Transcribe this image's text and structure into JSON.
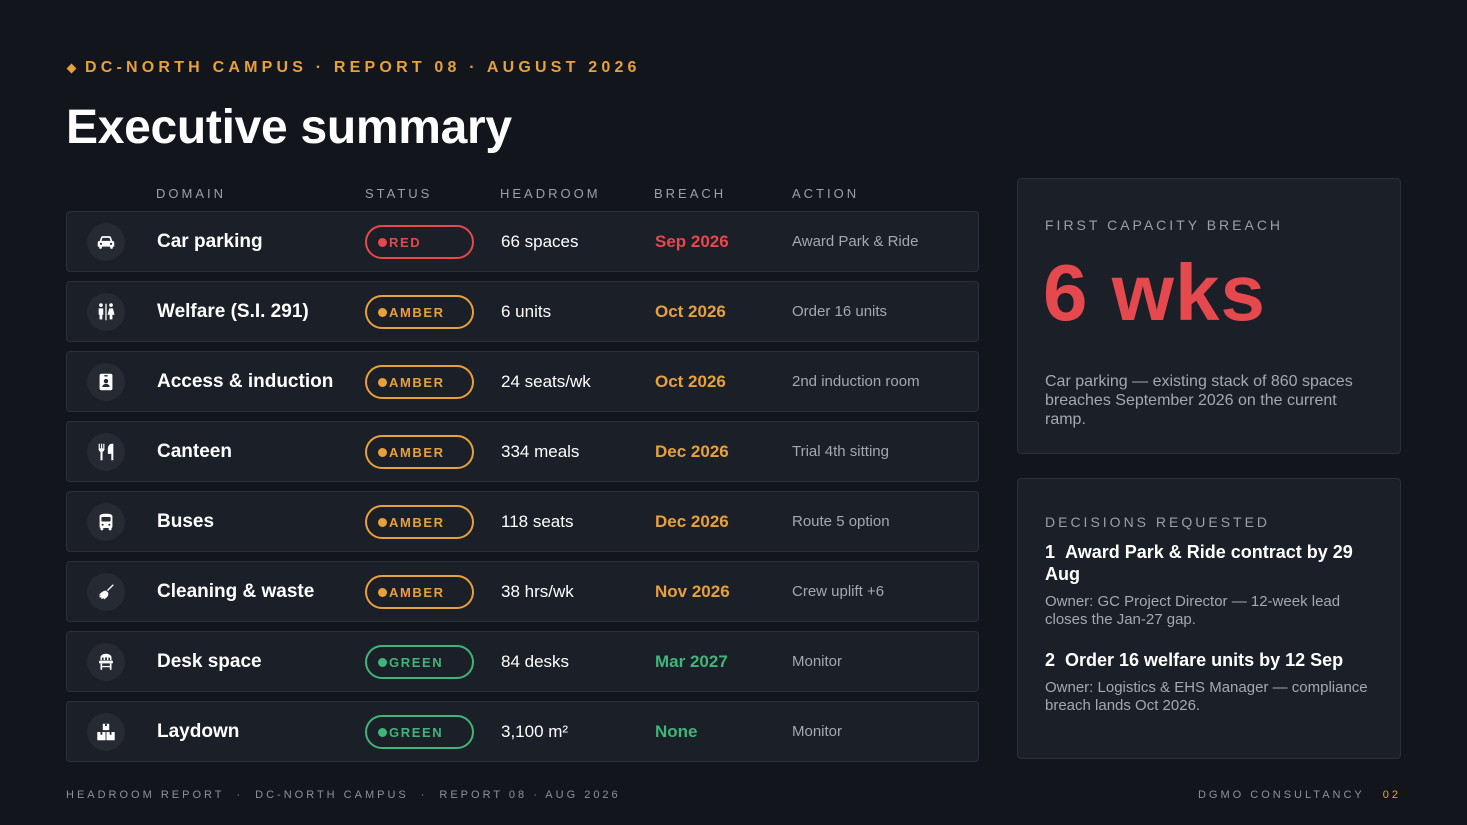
{
  "header": {
    "eyebrow": "DC-NORTH CAMPUS · REPORT 08 · AUGUST 2026",
    "title": "Executive summary"
  },
  "table": {
    "columns": [
      "DOMAIN",
      "STATUS",
      "HEADROOM",
      "BREACH",
      "ACTION"
    ],
    "rows": [
      {
        "icon": "car-icon",
        "domain": "Car parking",
        "status": "RED",
        "status_color": "#e5484d",
        "headroom": "66 spaces",
        "breach": "Sep 2026",
        "action": "Award Park & Ride"
      },
      {
        "icon": "restroom-icon",
        "domain": "Welfare (S.I. 291)",
        "status": "AMBER",
        "status_color": "#e8a03b",
        "headroom": "6 units",
        "breach": "Oct 2026",
        "action": "Order 16 units"
      },
      {
        "icon": "id-badge-icon",
        "domain": "Access & induction",
        "status": "AMBER",
        "status_color": "#e8a03b",
        "headroom": "24 seats/wk",
        "breach": "Oct 2026",
        "action": "2nd induction room"
      },
      {
        "icon": "utensils-icon",
        "domain": "Canteen",
        "status": "AMBER",
        "status_color": "#e8a03b",
        "headroom": "334 meals",
        "breach": "Dec 2026",
        "action": "Trial 4th sitting"
      },
      {
        "icon": "bus-icon",
        "domain": "Buses",
        "status": "AMBER",
        "status_color": "#e8a03b",
        "headroom": "118 seats",
        "breach": "Dec 2026",
        "action": "Route 5 option"
      },
      {
        "icon": "broom-icon",
        "domain": "Cleaning & waste",
        "status": "AMBER",
        "status_color": "#e8a03b",
        "headroom": "38 hrs/wk",
        "breach": "Nov 2026",
        "action": "Crew uplift +6"
      },
      {
        "icon": "chair-icon",
        "domain": "Desk space",
        "status": "GREEN",
        "status_color": "#3fb57a",
        "headroom": "84 desks",
        "breach": "Mar 2027",
        "action": "Monitor"
      },
      {
        "icon": "boxes-icon",
        "domain": "Laydown",
        "status": "GREEN",
        "status_color": "#3fb57a",
        "headroom": "3,100 m²",
        "breach": "None",
        "action": "Monitor"
      }
    ]
  },
  "breach_card": {
    "label": "FIRST CAPACITY BREACH",
    "value": "6 wks",
    "value_color": "#e5484d",
    "description": "Car parking — existing stack of 860 spaces breaches September 2026 on the current ramp."
  },
  "decisions_card": {
    "label": "DECISIONS REQUESTED",
    "items": [
      {
        "number": "1",
        "title": "Award Park & Ride contract by 29 Aug",
        "detail": "Owner: GC Project Director — 12-week lead closes the Jan-27 gap."
      },
      {
        "number": "2",
        "title": "Order 16 welfare units by 12 Sep",
        "detail": "Owner: Logistics & EHS Manager — compliance breach lands Oct 2026."
      }
    ]
  },
  "footer": {
    "left": [
      "HEADROOM REPORT",
      "DC-NORTH CAMPUS",
      "REPORT 08 · AUG 2026"
    ],
    "separator": "·",
    "right": "DGMO CONSULTANCY",
    "page": "02"
  },
  "colors": {
    "accent": "#e8a03b",
    "red": "#e5484d",
    "amber": "#e8a03b",
    "green": "#3fb57a",
    "background": "#12151c",
    "card": "#1b1f27"
  }
}
